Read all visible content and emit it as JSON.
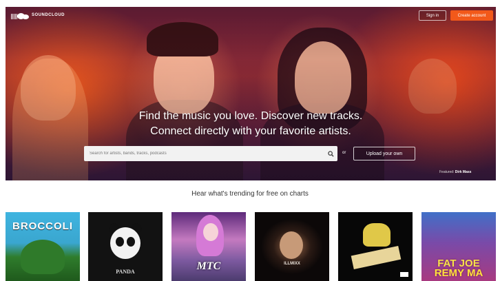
{
  "header": {
    "brand": "SOUNDCLOUD",
    "signin_label": "Sign in",
    "create_account_label": "Create account"
  },
  "hero": {
    "headline_line1": "Find the music you love. Discover new tracks.",
    "headline_line2": "Connect directly with your favorite artists.",
    "search_placeholder": "Search for artists, bands, tracks, podcasts",
    "or_label": "or",
    "upload_label": "Upload your own",
    "credit_prefix": "Featured:",
    "credit_artist": "Dirk Mass"
  },
  "trending": {
    "heading": "Hear what's trending for free on charts",
    "tiles": [
      {
        "title": "BROCCOLI"
      },
      {
        "title": "PANDA"
      },
      {
        "title": "MTC"
      },
      {
        "title": "ILLMIXX"
      },
      {
        "title": ""
      },
      {
        "title_line1": "FAT JOE",
        "title_line2": "REMY MA"
      }
    ]
  },
  "colors": {
    "accent": "#f2591a",
    "hero_dark": "#5a1e3c"
  },
  "icons": [
    "soundcloud-logo-icon",
    "search-icon"
  ]
}
